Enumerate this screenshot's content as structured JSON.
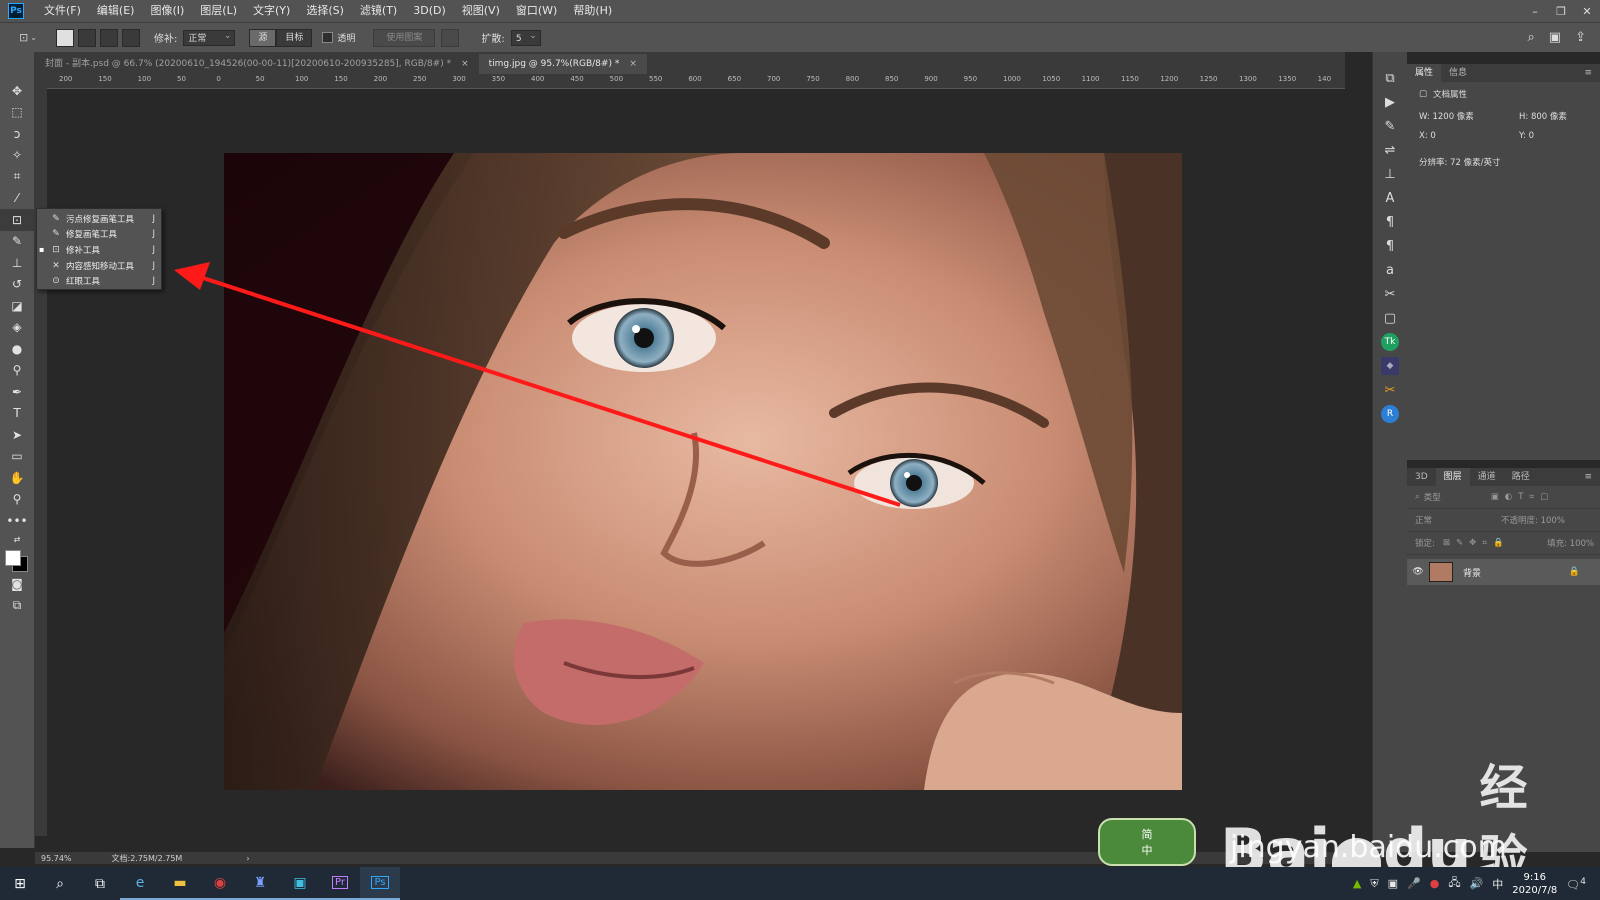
{
  "menubar": {
    "items": [
      "文件(F)",
      "编辑(E)",
      "图像(I)",
      "图层(L)",
      "文字(Y)",
      "选择(S)",
      "滤镜(T)",
      "3D(D)",
      "视图(V)",
      "窗口(W)",
      "帮助(H)"
    ],
    "app_icon": "Ps"
  },
  "options": {
    "patch_label": "修补:",
    "patch_value": "正常",
    "source": "源",
    "target": "目标",
    "transparent": "透明",
    "use_pattern": "使用图案",
    "diffusion_label": "扩散:",
    "diffusion_value": "5"
  },
  "tabs": [
    {
      "title": "封面 - 副本.psd @ 66.7% (20200610_194526(00-00-11)[20200610-200935285], RGB/8#) *",
      "close": "×"
    },
    {
      "title": "timg.jpg @ 95.7%(RGB/8#) *",
      "close": "×"
    }
  ],
  "ruler": {
    "h_ticks": [
      "200",
      "150",
      "100",
      "50",
      "0",
      "50",
      "100",
      "150",
      "200",
      "250",
      "300",
      "350",
      "400",
      "450",
      "500",
      "550",
      "600",
      "650",
      "700",
      "750",
      "800",
      "850",
      "900",
      "950",
      "1000",
      "1050",
      "1100",
      "1150",
      "1200",
      "1250",
      "1300",
      "1350",
      "140"
    ]
  },
  "flyout": {
    "items": [
      {
        "label": "污点修复画笔工具",
        "key": "J",
        "icon": "spot-healing-brush-icon",
        "glyph": "✎"
      },
      {
        "label": "修复画笔工具",
        "key": "J",
        "icon": "healing-brush-icon",
        "glyph": "✎"
      },
      {
        "label": "修补工具",
        "key": "J",
        "icon": "patch-icon",
        "glyph": "⊡",
        "selected": true
      },
      {
        "label": "内容感知移动工具",
        "key": "J",
        "icon": "content-aware-move-icon",
        "glyph": "✕"
      },
      {
        "label": "红眼工具",
        "key": "J",
        "icon": "red-eye-icon",
        "glyph": "⊙"
      }
    ]
  },
  "status": {
    "zoom": "95.74%",
    "doc": "文档:2.75M/2.75M"
  },
  "properties": {
    "tabs": [
      "属性",
      "信息"
    ],
    "header": "文档属性",
    "w": "W:  1200 像素",
    "h": "H:  800 像素",
    "x": "X:  0",
    "y": "Y:  0",
    "resolution": "分辨率: 72 像素/英寸"
  },
  "layers": {
    "tabs": [
      "3D",
      "图层",
      "通道",
      "路径"
    ],
    "kind": "类型",
    "blend": "正常",
    "opacity": "不透明度: 100%",
    "lock": "锁定:",
    "fill": "填充: 100%",
    "layer_name": "背景"
  },
  "taskbar": {
    "time": "9:16",
    "date": "2020/7/8",
    "ime": "中",
    "notif": "4"
  },
  "ime_badge": {
    "top": "简",
    "bottom": "中"
  },
  "watermark": {
    "brand": "Bai",
    "brand2": "du",
    "cn": "经验",
    "url": "jingyan.baidu.com"
  },
  "colors": {
    "accent_arrow": "#ff1a1a",
    "ps_blue": "#31a8ff",
    "panel": "#474747"
  }
}
